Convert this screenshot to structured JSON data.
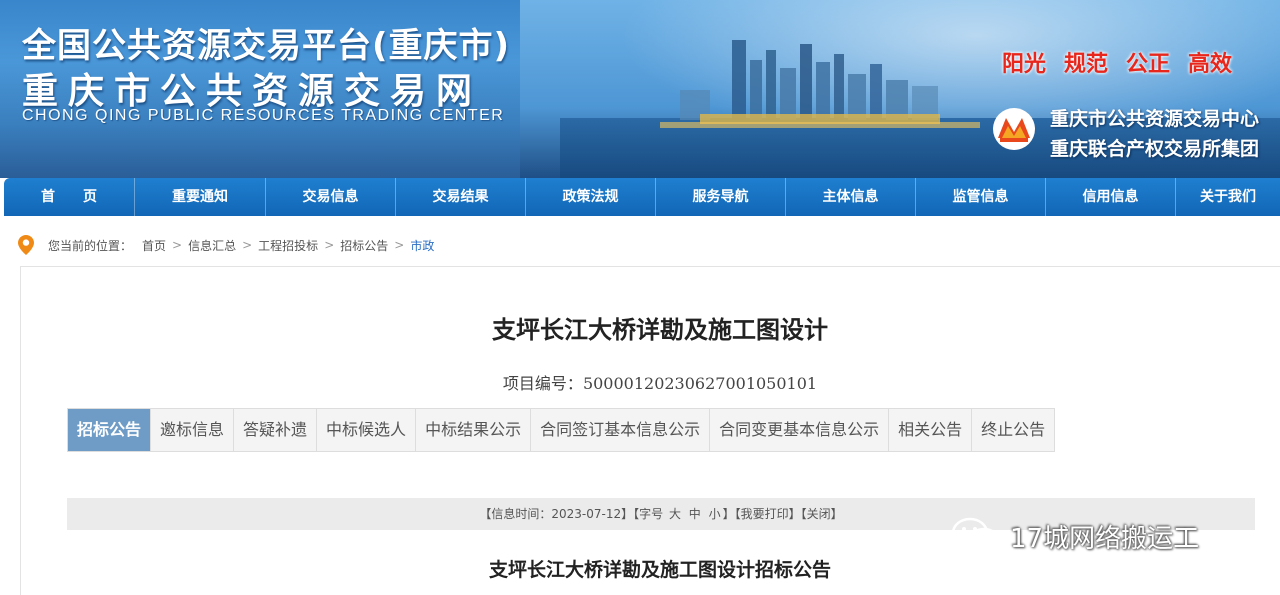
{
  "header": {
    "title_line1": "全国公共资源交易平台(重庆市)",
    "title_line2": "重庆市公共资源交易网",
    "title_en": "CHONG QING PUBLIC RESOURCES TRADING CENTER",
    "slogans": [
      "阳光",
      "规范",
      "公正",
      "高效"
    ],
    "org_line1": "重庆市公共资源交易中心",
    "org_line2": "重庆联合产权交易所集团",
    "slogan_color": "#e8261b"
  },
  "nav": {
    "items": [
      "首　　页",
      "重要通知",
      "交易信息",
      "交易结果",
      "政策法规",
      "服务导航",
      "主体信息",
      "监管信息",
      "信用信息",
      "关于我们"
    ]
  },
  "breadcrumb": {
    "prefix": "您当前的位置：",
    "items": [
      "首页",
      "信息汇总",
      "工程招投标",
      "招标公告"
    ],
    "current": "市政",
    "separator": ">"
  },
  "document": {
    "title": "支坪长江大桥详勘及施工图设计",
    "project_no_label": "项目编号：",
    "project_no": "500001202306270010501​01"
  },
  "tabs": {
    "items": [
      "招标公告",
      "邀标信息",
      "答疑补遗",
      "中标候选人",
      "中标结果公示",
      "合同签订基本信息公示",
      "合同变更基本信息公示",
      "相关公告",
      "终止公告"
    ],
    "active_index": 0
  },
  "info_bar": {
    "time_label": "【信息时间：",
    "time_value": "2023-07-12",
    "font_open": "】【字号",
    "font_large": "大",
    "font_medium": "中",
    "font_small": "小",
    "print": "】【我要打印】",
    "close": "【关闭】"
  },
  "notice": {
    "title": "支坪长江大桥详勘及施工图设计招标公告"
  },
  "watermark": {
    "text": "17城网络搬运工"
  }
}
